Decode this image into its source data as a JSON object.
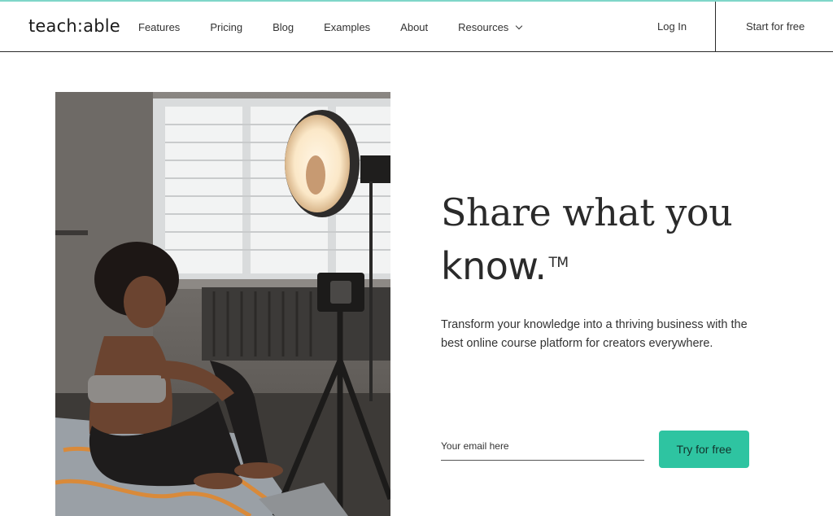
{
  "brand": {
    "logo": "teach:able"
  },
  "nav": {
    "items": [
      {
        "label": "Features"
      },
      {
        "label": "Pricing"
      },
      {
        "label": "Blog"
      },
      {
        "label": "Examples"
      },
      {
        "label": "About"
      },
      {
        "label": "Resources",
        "has_dropdown": true
      }
    ],
    "login": "Log In",
    "start": "Start for free"
  },
  "hero": {
    "headline_line1": "Share what you",
    "headline_line2": "know.",
    "trademark": "TM",
    "subtitle": "Transform your knowledge into a thriving business with the best online course platform for creators everywhere.",
    "email_placeholder": "Your email here",
    "cta": "Try for free"
  },
  "colors": {
    "accent": "#2ec4a1",
    "top_rule": "#7fd6c9",
    "text": "#2a2a2a"
  }
}
